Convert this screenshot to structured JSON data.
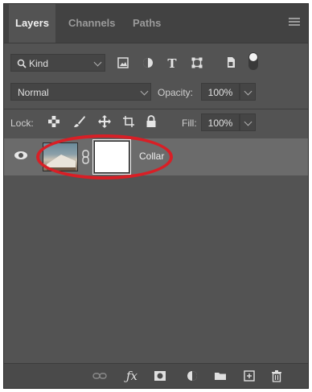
{
  "tabs": [
    {
      "label": "Layers",
      "active": true
    },
    {
      "label": "Channels",
      "active": false
    },
    {
      "label": "Paths",
      "active": false
    }
  ],
  "filter": {
    "kind_label": "Kind"
  },
  "blend": {
    "mode": "Normal",
    "opacity_label": "Opacity:",
    "opacity_value": "100%"
  },
  "lock": {
    "label": "Lock:",
    "fill_label": "Fill:",
    "fill_value": "100%"
  },
  "layers": [
    {
      "name": "Collar",
      "visible": true,
      "selected": true
    }
  ],
  "colors": {
    "annotation": "#d81f26",
    "panel": "#535353"
  }
}
